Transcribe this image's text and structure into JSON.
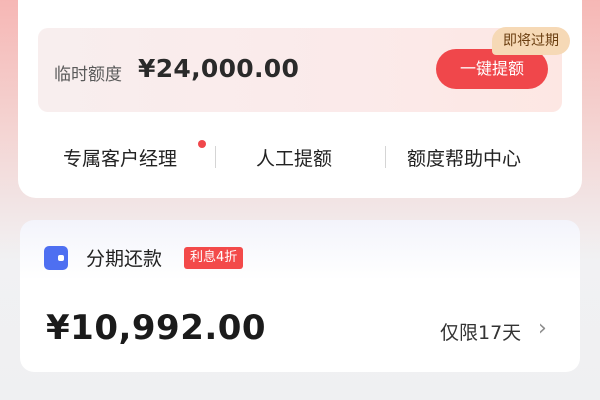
{
  "credit": {
    "temp_quota_label": "临时额度",
    "temp_quota_amount": "¥24,000.00",
    "boost_button": "一键提额",
    "expiring_tag": "即将过期"
  },
  "links": [
    {
      "label": "专属客户经理",
      "has_red_dot": true
    },
    {
      "label": "人工提额"
    },
    {
      "label": "额度帮助中心"
    }
  ],
  "installment": {
    "title": "分期还款",
    "interest_badge": "利息4折",
    "amount": "¥10,992.00",
    "limit_text": "仅限17天",
    "chevron": "›"
  },
  "colors": {
    "accent_red": "#f0474b",
    "tag_bg": "#f6d9b6",
    "wallet_icon_blue": "#4e6ff1"
  },
  "icons": {
    "wallet": "wallet-icon",
    "chevron": "chevron-right-icon",
    "dot": "notification-dot-icon"
  }
}
